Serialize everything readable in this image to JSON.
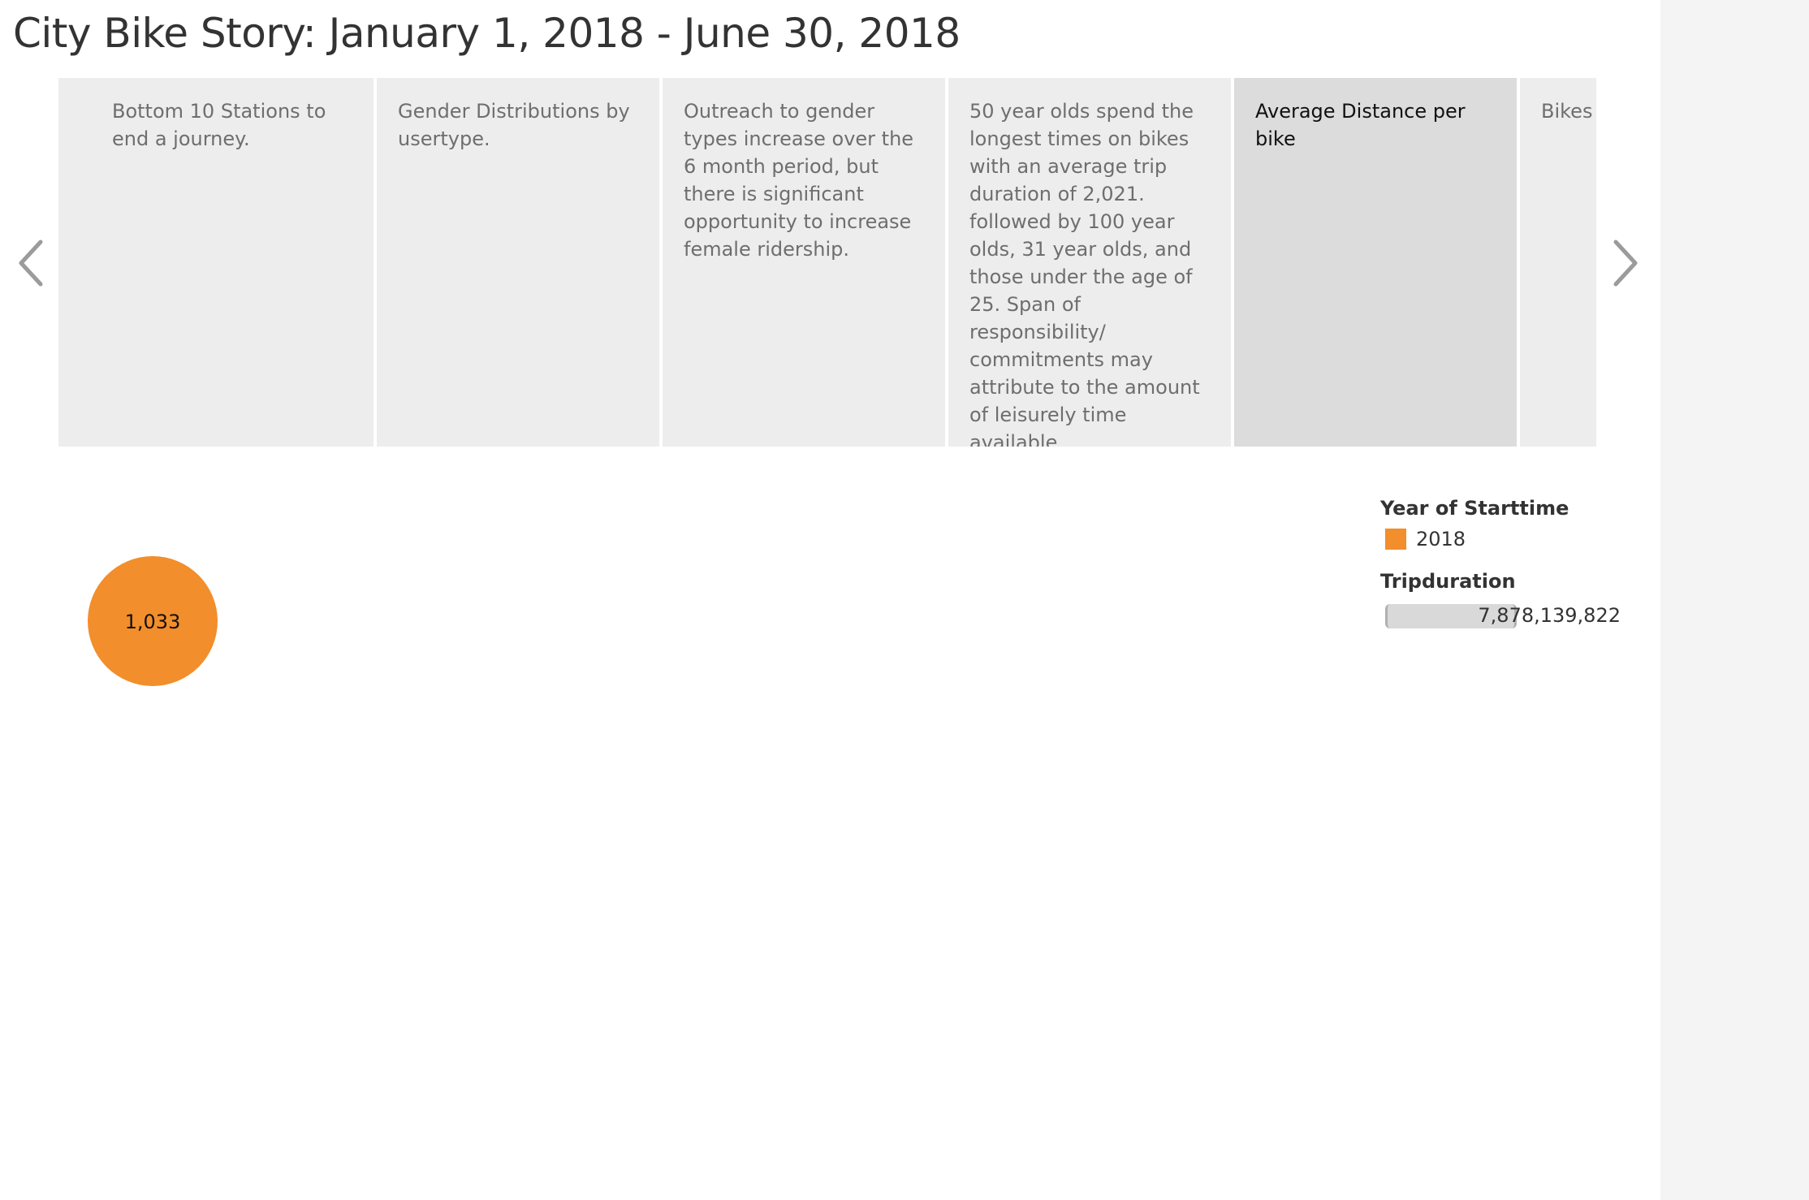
{
  "title": "City Bike Story: January 1, 2018 - June 30, 2018",
  "navigation": {
    "prev_icon": "chevron-left-icon",
    "next_icon": "chevron-right-icon"
  },
  "story_points": [
    {
      "text": ""
    },
    {
      "text": "Bottom 10 Stations to end a journey."
    },
    {
      "text": "Gender Distributions by usertype."
    },
    {
      "text": "Outreach to gender types increase over the 6 month period, but there is significant opportunity to increase female ridership."
    },
    {
      "text": "50 year olds spend the longest times on bikes with an average trip duration of 2,021. followed by 100 year olds, 31 year olds, and those under the age of 25. Span of responsibility/ commitments may attribute to the amount of leisurely time available."
    },
    {
      "text": "Average Distance per bike",
      "active": true
    },
    {
      "text": "Bikes usage the mo"
    }
  ],
  "legend": {
    "color_title": "Year of Starttime",
    "color_items": [
      {
        "label": "2018",
        "color": "#f28e2b"
      }
    ],
    "size_title": "Tripduration",
    "size_value": "7,878,139,822"
  },
  "chart_data": {
    "type": "scatter",
    "series": [
      {
        "name": "2018",
        "color": "#f28e2b",
        "values": [
          1033
        ],
        "labels": [
          "1,033"
        ]
      }
    ]
  }
}
